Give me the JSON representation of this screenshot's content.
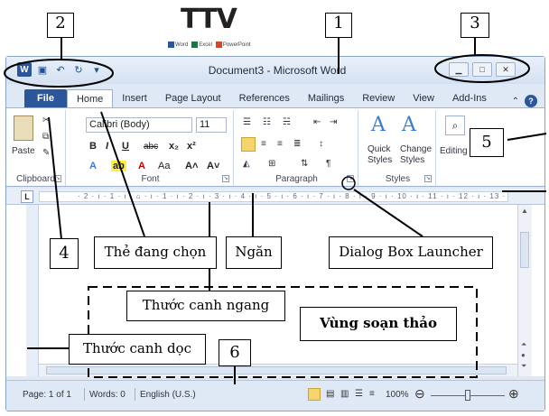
{
  "logo": {
    "text": "TTV",
    "apps": [
      "Word",
      "Excel",
      "PowerPoint"
    ]
  },
  "window": {
    "title": "Document3 - Microsoft Word",
    "app_icon": "W"
  },
  "tabs": [
    "File",
    "Home",
    "Insert",
    "Page Layout",
    "References",
    "Mailings",
    "Review",
    "View",
    "Add-Ins"
  ],
  "ribbon": {
    "clipboard": {
      "label": "Clipboard",
      "paste": "Paste"
    },
    "font": {
      "label": "Font",
      "name": "Calibri (Body)",
      "size": "11",
      "bold": "B",
      "italic": "I",
      "underline": "U",
      "strike": "abc",
      "sub": "x₂",
      "sup": "x²",
      "case": "Aa",
      "grow": "A˄",
      "shrink": "A˅"
    },
    "paragraph": {
      "label": "Paragraph"
    },
    "styles": {
      "label": "Styles",
      "quick1": "Quick",
      "quick2": "Styles",
      "change1": "Change",
      "change2": "Styles"
    },
    "editing": {
      "label": "Editing"
    }
  },
  "ruler": {
    "marks": "· 2 · ı · 1 · ı · ⌂ · ı · 1 · ı · 2 · ı · 3 · ı · 4 · ı · 5 · ı · 6 · ı · 7 · ı · 8 · ı · 9 · ı · 10 · ı · 11 · ı · 12 · ı · 13 · ı 14 · ı ·",
    "tab_box": "L"
  },
  "status": {
    "page": "Page: 1 of 1",
    "words": "Words: 0",
    "lang": "English (U.S.)",
    "zoom": "100%"
  },
  "annotations": {
    "n1": "1",
    "n2": "2",
    "n3": "3",
    "n4": "4",
    "n5": "5",
    "n6": "6",
    "the_dang_chon": "Thẻ đang chọn",
    "ngan": "Ngăn",
    "dialog_box_launcher": "Dialog Box Launcher",
    "thuoc_canh_ngang": "Thước canh ngang",
    "vung_soan_thao": "Vùng soạn thảo",
    "thuoc_canh_doc": "Thước canh dọc"
  }
}
